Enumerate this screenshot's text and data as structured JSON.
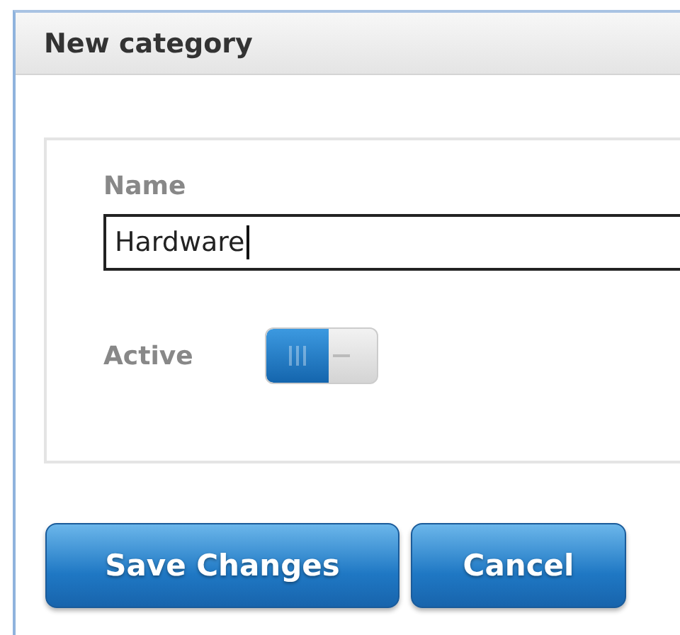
{
  "dialog": {
    "title": "New category"
  },
  "form": {
    "name_label": "Name",
    "name_value": "Hardware",
    "active_label": "Active",
    "active_on": true
  },
  "buttons": [
    {
      "label": "Save Changes"
    },
    {
      "label": "Cancel"
    }
  ]
}
